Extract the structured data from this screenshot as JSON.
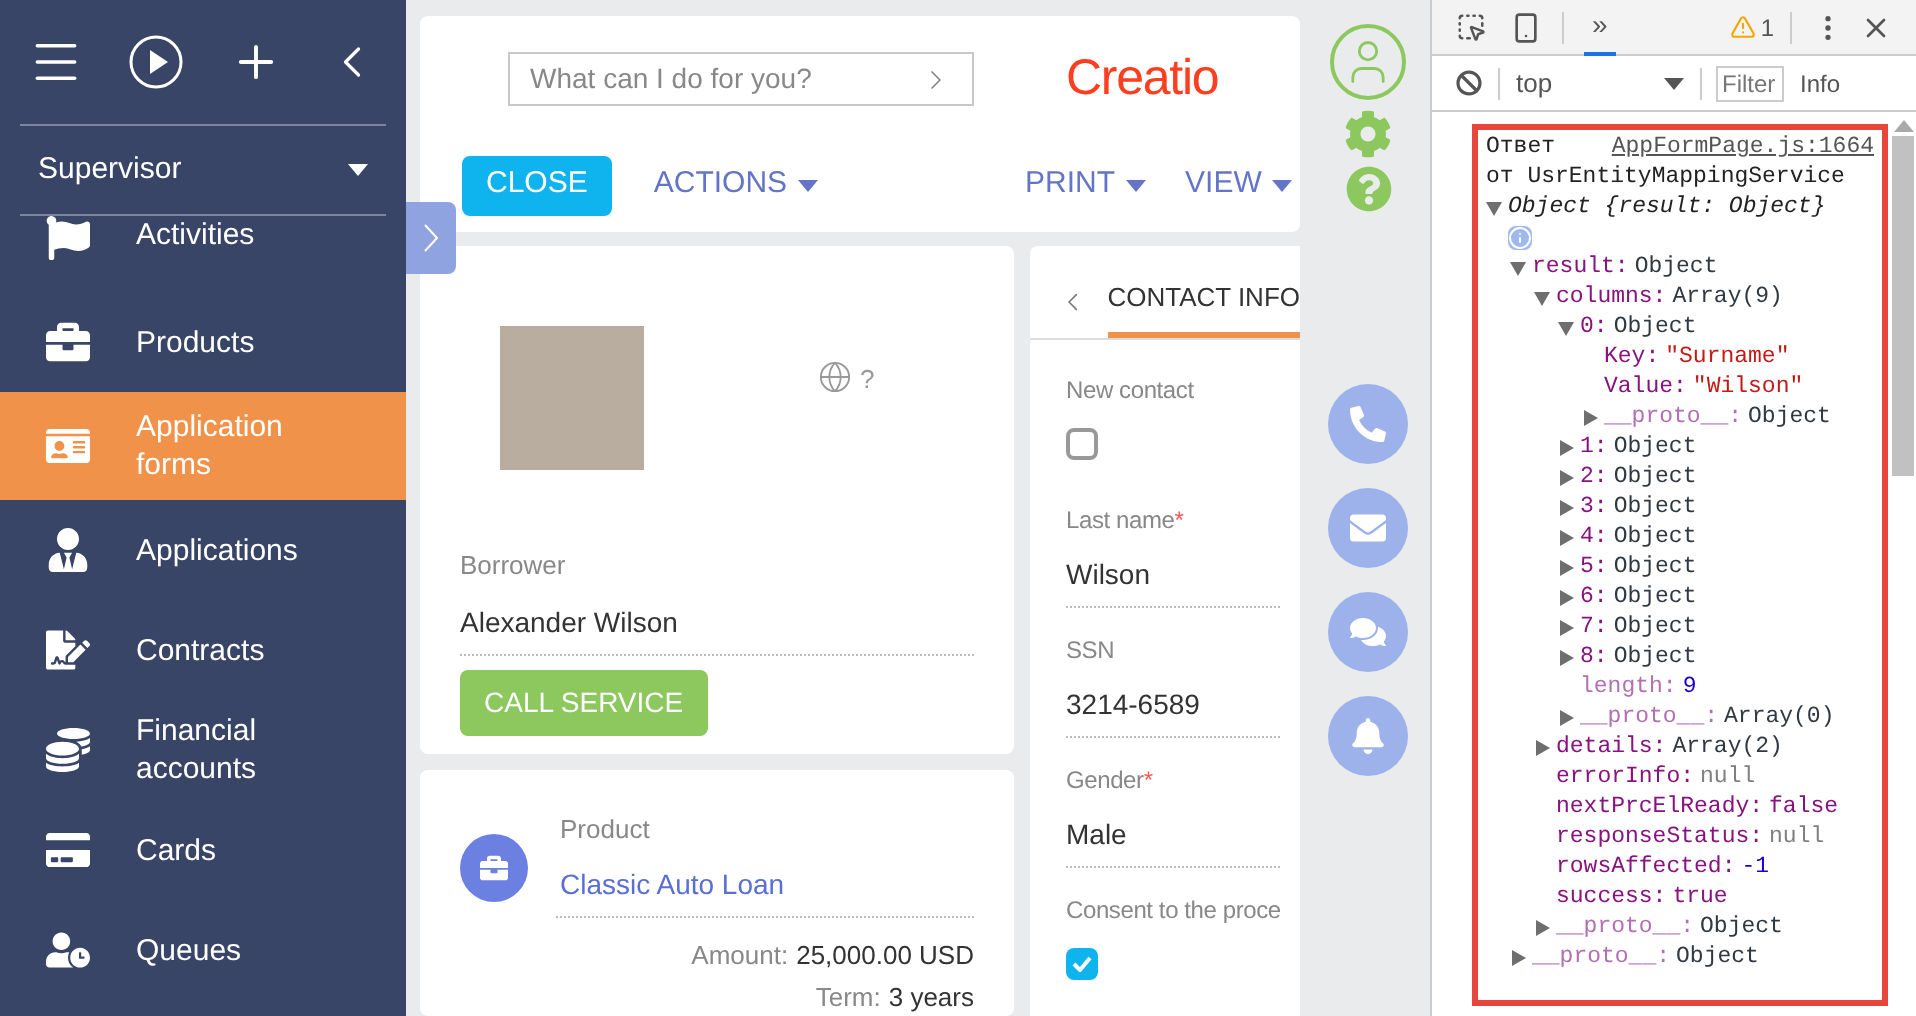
{
  "sidebar": {
    "workplace": "Supervisor",
    "items": [
      {
        "label": "Activities",
        "selected": false
      },
      {
        "label": "Products",
        "selected": false
      },
      {
        "label": "Application forms",
        "selected": true
      },
      {
        "label": "Applications",
        "selected": false
      },
      {
        "label": "Contracts",
        "selected": false
      },
      {
        "label": "Financial accounts",
        "selected": false
      },
      {
        "label": "Cards",
        "selected": false
      },
      {
        "label": "Queues",
        "selected": false
      }
    ]
  },
  "header": {
    "search": {
      "placeholder": "What can I do for you?"
    },
    "logo": "Creatio",
    "toolbar": {
      "close": "CLOSE",
      "actions": "ACTIONS",
      "print": "PRINT",
      "view": "VIEW"
    }
  },
  "borrower_card": {
    "help_mark": "?",
    "label": "Borrower",
    "value": "Alexander Wilson",
    "button": "CALL SERVICE"
  },
  "product_card": {
    "label": "Product",
    "value": "Classic Auto Loan",
    "amount_label": "Amount:",
    "amount": "25,000.00 USD",
    "term_label": "Term:",
    "term": "3 years"
  },
  "contact_panel": {
    "required_mark": "*",
    "tab": {
      "label": "CONTACT INFO",
      "selected": true
    },
    "fields": [
      {
        "kind": "checkbox",
        "label": "New contact",
        "checked": false
      },
      {
        "kind": "text",
        "label": "Last name",
        "required": true,
        "value": "Wilson"
      },
      {
        "kind": "text",
        "label": "SSN",
        "required": false,
        "value": "3214-6589"
      },
      {
        "kind": "text",
        "label": "Gender",
        "required": true,
        "value": "Male"
      },
      {
        "kind": "checkbox",
        "label": "Consent to the proce",
        "checked": true
      }
    ]
  },
  "devtools": {
    "tab": {
      "label": "»",
      "selected": true
    },
    "warnings": "1",
    "context": "top",
    "filter": {
      "placeholder": "Filter"
    },
    "level": "Info",
    "console": {
      "message": "Ответ",
      "source": "AppFormPage.js:1664",
      "message_line_2": "от UsrEntityMappingService",
      "tree": {
        "preview": "Object {result: Object}",
        "expanded": true,
        "children": [
          {
            "key": "result:",
            "value": "Object",
            "kind": "object",
            "expanded": true,
            "children": [
              {
                "key": "columns:",
                "value": "Array(9)",
                "kind": "object",
                "expanded": true,
                "children": [
                  {
                    "key": "0:",
                    "value": "Object",
                    "kind": "object",
                    "expanded": true,
                    "children": [
                      {
                        "key": "Key:",
                        "value": "\"Surname\"",
                        "kind": "string"
                      },
                      {
                        "key": "Value:",
                        "value": "\"Wilson\"",
                        "kind": "string"
                      },
                      {
                        "key": "__proto__:",
                        "value": "Object",
                        "kind": "object",
                        "expanded": false,
                        "dim": true
                      }
                    ]
                  },
                  {
                    "key": "1:",
                    "value": "Object",
                    "kind": "object",
                    "expanded": false
                  },
                  {
                    "key": "2:",
                    "value": "Object",
                    "kind": "object",
                    "expanded": false
                  },
                  {
                    "key": "3:",
                    "value": "Object",
                    "kind": "object",
                    "expanded": false
                  },
                  {
                    "key": "4:",
                    "value": "Object",
                    "kind": "object",
                    "expanded": false
                  },
                  {
                    "key": "5:",
                    "value": "Object",
                    "kind": "object",
                    "expanded": false
                  },
                  {
                    "key": "6:",
                    "value": "Object",
                    "kind": "object",
                    "expanded": false
                  },
                  {
                    "key": "7:",
                    "value": "Object",
                    "kind": "object",
                    "expanded": false
                  },
                  {
                    "key": "8:",
                    "value": "Object",
                    "kind": "object",
                    "expanded": false
                  },
                  {
                    "key": "length:",
                    "value": "9",
                    "kind": "number",
                    "dim": true
                  },
                  {
                    "key": "__proto__:",
                    "value": "Array(0)",
                    "kind": "object",
                    "expanded": false,
                    "dim": true
                  }
                ]
              },
              {
                "key": "details:",
                "value": "Array(2)",
                "kind": "object",
                "expanded": false
              },
              {
                "key": "errorInfo:",
                "value": "null",
                "kind": "null"
              },
              {
                "key": "nextPrcElReady:",
                "value": "false",
                "kind": "keyword"
              },
              {
                "key": "responseStatus:",
                "value": "null",
                "kind": "null"
              },
              {
                "key": "rowsAffected:",
                "value": "-1",
                "kind": "number"
              },
              {
                "key": "success:",
                "value": "true",
                "kind": "keyword"
              },
              {
                "key": "__proto__:",
                "value": "Object",
                "kind": "object",
                "expanded": false,
                "dim": true
              }
            ]
          },
          {
            "key": "__proto__:",
            "value": "Object",
            "kind": "object",
            "expanded": false,
            "dim": true
          }
        ]
      }
    }
  }
}
